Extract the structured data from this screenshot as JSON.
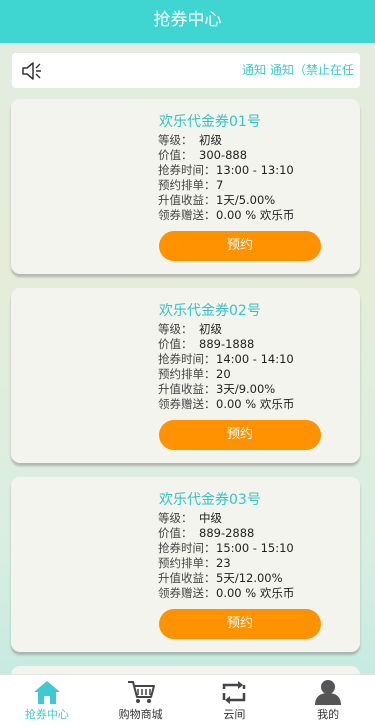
{
  "header": {
    "title": "抢券中心"
  },
  "notice": {
    "text": "通知 通知（禁止在任",
    "icon": "speaker-icon"
  },
  "labels": {
    "level": "等级：",
    "value": "价值：",
    "time": "抢券时间：",
    "queue": "预约排单：",
    "yield": "升值收益：",
    "gift": "领券赠送："
  },
  "coupons": [
    {
      "title": "欢乐代金券01号",
      "level": "初级",
      "value": "300-888",
      "time": "13:00 - 13:10",
      "queue": "7",
      "yield": "1天/5.00%",
      "gift": "0.00 % 欢乐币",
      "button": "预约"
    },
    {
      "title": "欢乐代金券02号",
      "level": "初级",
      "value": "889-1888",
      "time": "14:00 - 14:10",
      "queue": "20",
      "yield": "3天/9.00%",
      "gift": "0.00 % 欢乐币",
      "button": "预约"
    },
    {
      "title": "欢乐代金券03号",
      "level": "中级",
      "value": "889-2888",
      "time": "15:00 - 15:10",
      "queue": "23",
      "yield": "5天/12.00%",
      "gift": "0.00 % 欢乐币",
      "button": "预约"
    }
  ],
  "tabbar": [
    {
      "label": "抢券中心",
      "icon": "home-icon",
      "active": true
    },
    {
      "label": "购物商城",
      "icon": "cart-icon",
      "active": false
    },
    {
      "label": "云间",
      "icon": "exchange-icon",
      "active": false
    },
    {
      "label": "我的",
      "icon": "user-icon",
      "active": false
    }
  ],
  "colors": {
    "accent": "#3fd6d2",
    "button": "#ff9200",
    "title": "#35c3c6"
  }
}
